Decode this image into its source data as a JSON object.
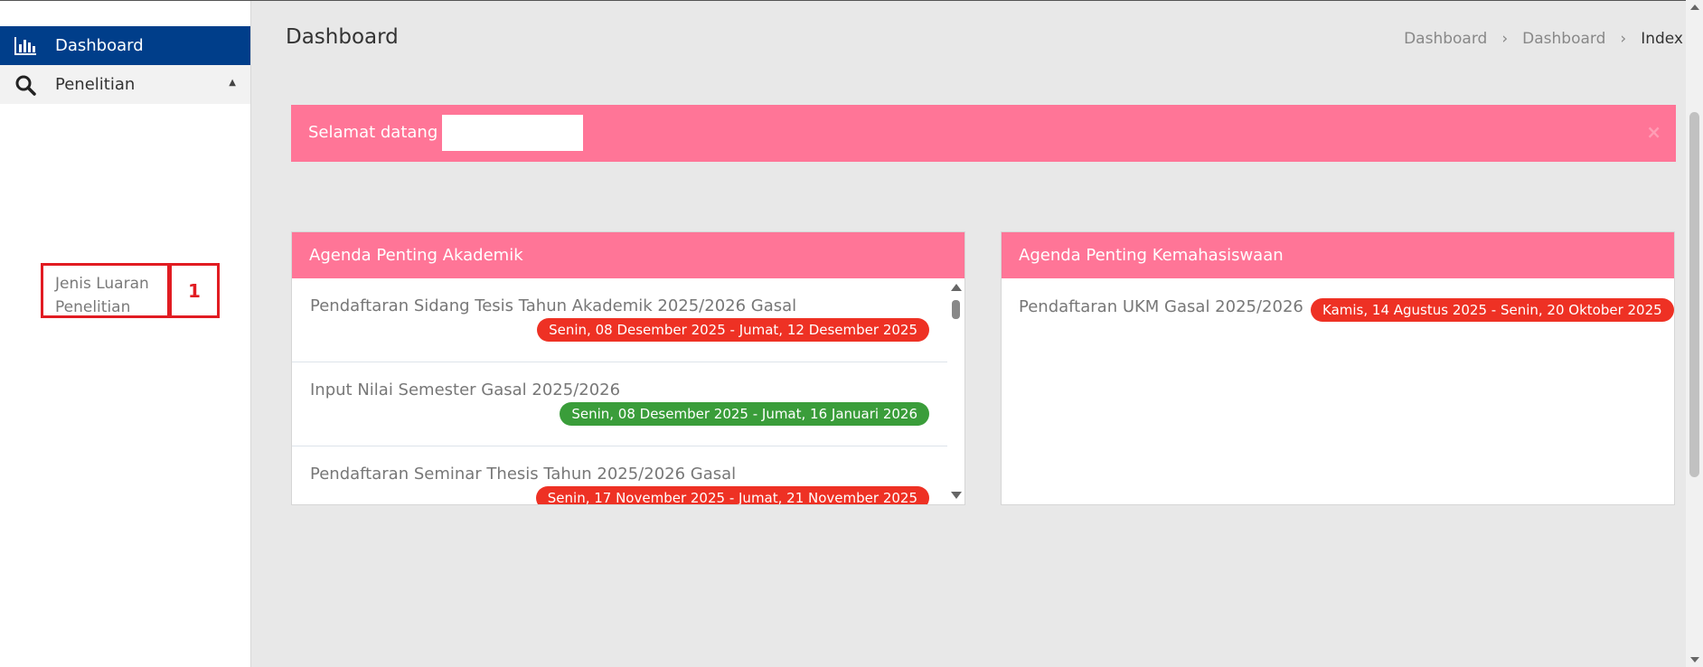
{
  "sidebar": {
    "items": [
      {
        "label": "Dashboard",
        "icon": "bar-chart-icon"
      },
      {
        "label": "Penelitian",
        "icon": "search-icon"
      }
    ],
    "submenu": {
      "label": "Jenis Luaran Penelitian"
    },
    "annotation_badge": "1"
  },
  "header": {
    "title": "Dashboard",
    "breadcrumb": [
      "Dashboard",
      "Dashboard",
      "Index"
    ]
  },
  "alert": {
    "text": "Selamat datang",
    "close": "×"
  },
  "agenda_akademik": {
    "title": "Agenda Penting Akademik",
    "items": [
      {
        "title": "Pendaftaran Sidang Tesis Tahun Akademik 2025/2026 Gasal",
        "date": "Senin, 08 Desember 2025 - Jumat, 12 Desember 2025",
        "status_color": "#ee3124"
      },
      {
        "title": "Input Nilai Semester Gasal 2025/2026",
        "date": "Senin, 08 Desember 2025 - Jumat, 16 Januari 2026",
        "status_color": "#3a9d3a"
      },
      {
        "title": "Pendaftaran Seminar Thesis Tahun 2025/2026 Gasal",
        "date": "Senin, 17 November 2025 - Jumat, 21 November 2025",
        "status_color": "#ee3124"
      }
    ]
  },
  "agenda_kemahasiswaan": {
    "title": "Agenda Penting Kemahasiswaan",
    "items": [
      {
        "title": "Pendaftaran UKM Gasal 2025/2026",
        "date": "Kamis, 14 Agustus 2025 - Senin, 20 Oktober 2025",
        "status_color": "#ee3124"
      }
    ]
  },
  "colors": {
    "sidebar_active": "#003e8a",
    "accent_pink": "#ff7597",
    "badge_red": "#ee3124",
    "badge_green": "#3a9d3a",
    "annotation_red": "#e11c22"
  }
}
